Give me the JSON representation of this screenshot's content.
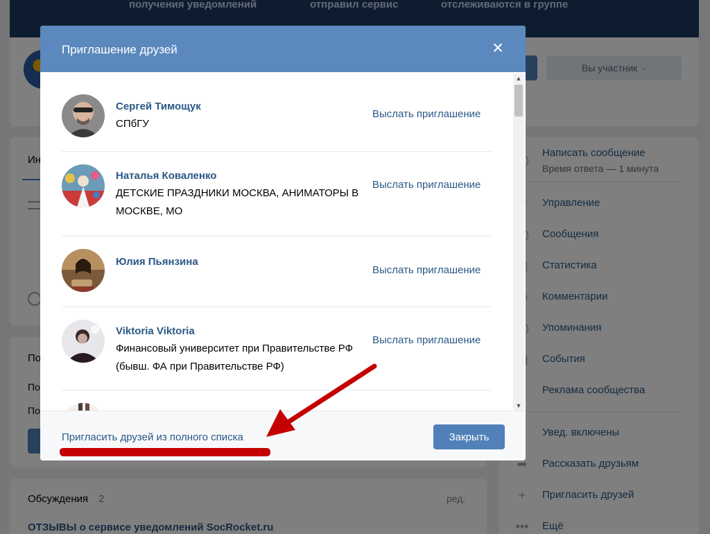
{
  "background": {
    "cover_texts": [
      "получения уведомлений",
      "отправил сервис",
      "отслеживаются в группе"
    ],
    "member_button": "Вы участник",
    "tab_partial": "Ин",
    "left_fragments": [
      "По",
      "По",
      "По"
    ],
    "discussions": {
      "title": "Обсуждения",
      "count": "2",
      "edit": "ред.",
      "topic": "ОТЗЫВЫ о сервисе уведомлений SocRocket.ru"
    },
    "sidebar": {
      "message": "Написать сообщение",
      "reply_time": "Время ответа — 1 минута",
      "items": [
        "Управление",
        "Сообщения",
        "Статистика",
        "Комментарии",
        "Упоминания",
        "События",
        "Реклама сообщества"
      ],
      "items2": [
        "Увед. включены",
        "Рассказать друзьям",
        "Пригласить друзей",
        "Ещё"
      ]
    }
  },
  "modal": {
    "title": "Приглашение друзей",
    "invite_label": "Выслать приглашение",
    "friends": [
      {
        "name": "Сергей Тимощук",
        "sub": "СПбГУ"
      },
      {
        "name": "Наталья Коваленко",
        "sub": "ДЕТСКИЕ ПРАЗДНИКИ МОСКВА, АНИМАТОРЫ В МОСКВЕ, МО"
      },
      {
        "name": "Юлия Пьянзина",
        "sub": ""
      },
      {
        "name": "Viktoria Viktoria",
        "sub": "Финансовый университет при Правительстве РФ (бывш. ФА при Правительстве РФ)"
      }
    ],
    "footer_link": "Пригласить друзей из полного списка",
    "close_button": "Закрыть"
  },
  "colors": {
    "header": "#5b88bd",
    "link": "#2a5885",
    "button": "#5181b8",
    "annotation": "#c40000"
  }
}
